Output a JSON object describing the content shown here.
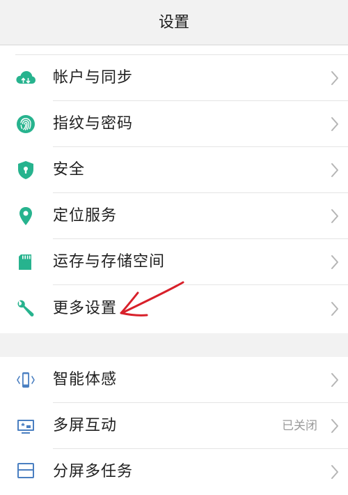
{
  "header": {
    "title": "设置"
  },
  "sections": [
    {
      "items": [
        {
          "label": "帐户与同步",
          "icon": "cloud-sync-icon",
          "value": ""
        },
        {
          "label": "指纹与密码",
          "icon": "fingerprint-icon",
          "value": ""
        },
        {
          "label": "安全",
          "icon": "shield-icon",
          "value": ""
        },
        {
          "label": "定位服务",
          "icon": "location-pin-icon",
          "value": ""
        },
        {
          "label": "运存与存储空间",
          "icon": "sd-card-icon",
          "value": ""
        },
        {
          "label": "更多设置",
          "icon": "wrench-icon",
          "value": ""
        }
      ]
    },
    {
      "items": [
        {
          "label": "智能体感",
          "icon": "phone-motion-icon",
          "value": ""
        },
        {
          "label": "多屏互动",
          "icon": "screen-cast-icon",
          "value": "已关闭"
        },
        {
          "label": "分屏多任务",
          "icon": "split-screen-icon",
          "value": ""
        }
      ]
    }
  ],
  "colors": {
    "accent_green": "#27b38e",
    "accent_blue": "#4a7fc1",
    "annotation_red": "#d8202a"
  }
}
